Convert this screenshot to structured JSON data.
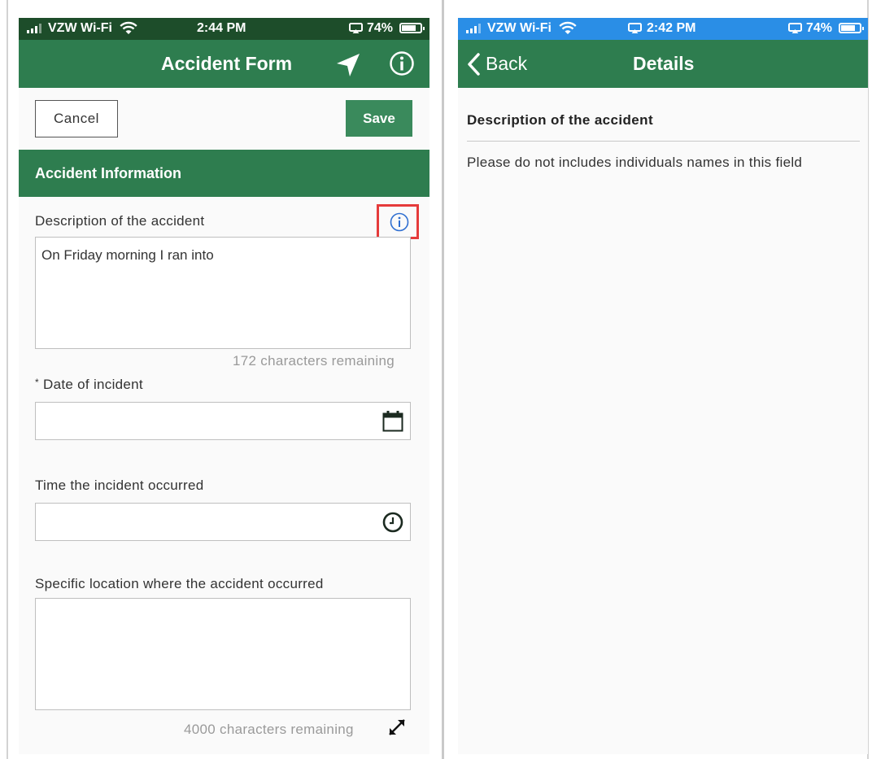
{
  "left_screen": {
    "status_bar": {
      "carrier": "VZW Wi-Fi",
      "time": "2:44 PM",
      "battery": "74%"
    },
    "nav": {
      "title": "Accident Form",
      "icons": [
        "location-arrow-icon",
        "info-circle-icon"
      ]
    },
    "toolbar": {
      "cancel_label": "Cancel",
      "save_label": "Save"
    },
    "section": {
      "title": "Accident Information"
    },
    "fields": {
      "description": {
        "label": "Description of the accident",
        "value": "On Friday morning I ran into",
        "counter": "172 characters remaining"
      },
      "date": {
        "required_mark": "*",
        "label": "Date of incident",
        "value": "",
        "icon": "calendar-icon"
      },
      "time": {
        "label": "Time the incident occurred",
        "value": "",
        "icon": "clock-icon"
      },
      "location": {
        "label": "Specific location where the accident occurred",
        "value": "",
        "counter": "4000 characters remaining",
        "icon": "expand-icon"
      }
    }
  },
  "right_screen": {
    "status_bar": {
      "carrier": "VZW Wi-Fi",
      "time": "2:42 PM",
      "battery": "74%"
    },
    "nav": {
      "back_label": "Back",
      "title": "Details"
    },
    "detail": {
      "heading": "Description of the accident",
      "text": "Please do not includes individuals names in this field"
    }
  },
  "colors": {
    "header_green": "#2e7d4f",
    "save_green": "#3a8a5c",
    "status_dark_green": "#1d4d2a",
    "status_blue": "#2a8ee6",
    "highlight_red": "#e53b3b",
    "info_blue": "#2f6fd1"
  }
}
